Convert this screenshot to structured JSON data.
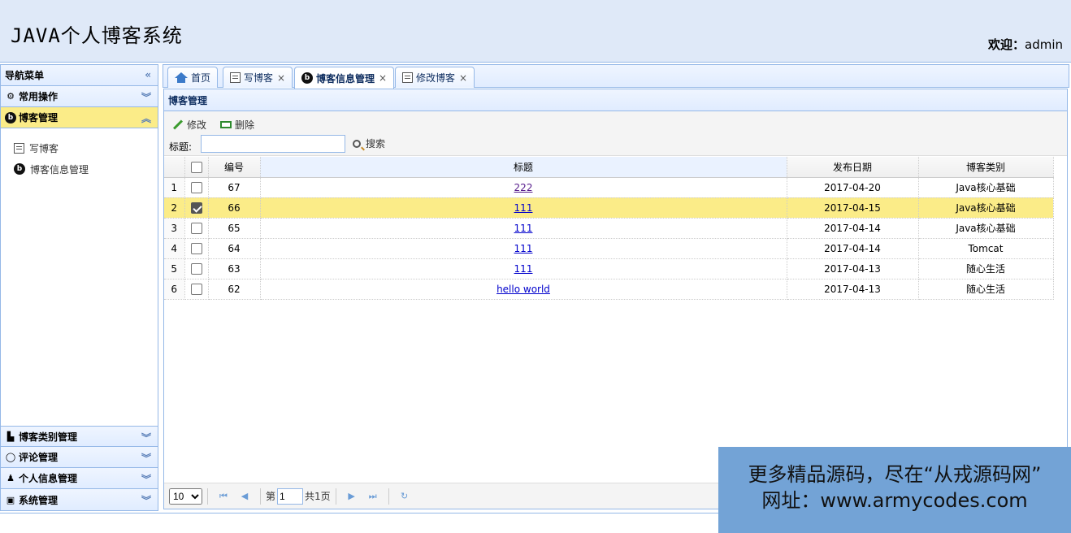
{
  "header": {
    "title": "JAVA个人博客系统",
    "welcome_label": "欢迎：",
    "username": "admin"
  },
  "sidebar": {
    "title": "导航菜单",
    "sections": [
      {
        "label": "常用操作",
        "icon": "gear-icon"
      },
      {
        "label": "博客管理",
        "icon": "blog-icon"
      }
    ],
    "items": [
      {
        "label": "写博客",
        "icon": "edit-icon"
      },
      {
        "label": "博客信息管理",
        "icon": "blog-icon"
      }
    ],
    "bottom_sections": [
      {
        "label": "博客类别管理",
        "icon": "category-icon"
      },
      {
        "label": "评论管理",
        "icon": "comment-icon"
      },
      {
        "label": "个人信息管理",
        "icon": "user-icon"
      },
      {
        "label": "系统管理",
        "icon": "system-icon"
      }
    ]
  },
  "tabs": [
    {
      "label": "首页",
      "icon": "home-icon"
    },
    {
      "label": "写博客",
      "icon": "edit-icon",
      "close": "×"
    },
    {
      "label": "博客信息管理",
      "icon": "blog-icon",
      "close": "×"
    },
    {
      "label": "修改博客",
      "icon": "edit-icon",
      "close": "×"
    }
  ],
  "panel": {
    "title": "博客管理",
    "toolbar": {
      "edit_label": "修改",
      "delete_label": "删除",
      "search_label": "标题:",
      "search_value": "",
      "search_button": "搜索"
    },
    "columns": [
      "编号",
      "标题",
      "发布日期",
      "博客类别"
    ],
    "rows": [
      {
        "rn": "1",
        "checked": false,
        "id": "67",
        "title": "222",
        "date": "2017-04-20",
        "type": "Java核心基础"
      },
      {
        "rn": "2",
        "checked": true,
        "id": "66",
        "title": "111",
        "date": "2017-04-15",
        "type": "Java核心基础"
      },
      {
        "rn": "3",
        "checked": false,
        "id": "65",
        "title": "111",
        "date": "2017-04-14",
        "type": "Java核心基础"
      },
      {
        "rn": "4",
        "checked": false,
        "id": "64",
        "title": "111",
        "date": "2017-04-14",
        "type": "Tomcat"
      },
      {
        "rn": "5",
        "checked": false,
        "id": "63",
        "title": "111",
        "date": "2017-04-13",
        "type": "随心生活"
      },
      {
        "rn": "6",
        "checked": false,
        "id": "62",
        "title": "hello world",
        "date": "2017-04-13",
        "type": "随心生活"
      }
    ],
    "pager": {
      "page_size": "10",
      "page_prefix": "第",
      "page": "1",
      "total": "共1页"
    }
  },
  "watermark": {
    "line1": "更多精品源码，尽在“从戎源码网”",
    "line2": "网址：www.armycodes.com"
  },
  "colors": {
    "accent": "#95b8e7",
    "selected": "#fbec88",
    "header_bg": "#dfe9f8"
  }
}
